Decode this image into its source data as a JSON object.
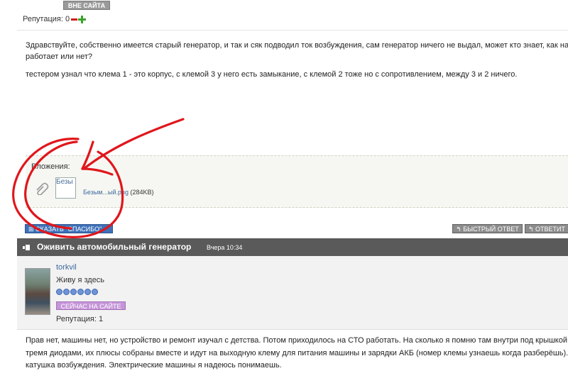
{
  "top_author": {
    "status_label": "ВНЕ САЙТА",
    "reputation_label": "Репутация: 0"
  },
  "post1": {
    "lines": [
      "Здравствуйте, собственно имеется старый генератор, и так и сяк подводил ток возбуждения, сам генератор ничего не выдал, может кто знает, как наверня",
      "работает или нет?",
      "тестером узнал что клема 1 - это корпус, с клемой 3 у него есть замыкание, с клемой 2 тоже но с сопротивлением, между 3 и 2 ничего."
    ],
    "attachments_title": "Вложения:",
    "attachment_thumb_text": "Безы",
    "attachment_name": "Безым...ый.png",
    "attachment_size": "(284KB)"
  },
  "actions": {
    "thanks_label": "СКАЗАТЬ \"СПАСИБО\"",
    "quick_reply_label": "БЫСТРЫЙ ОТВЕТ",
    "reply_label": "ОТВЕТИТ"
  },
  "post2": {
    "title": "Оживить автомобильный генератор",
    "date": "Вчера 10:34",
    "author_name": "torkvil",
    "author_title": "Живу я здесь",
    "status_label": "СЕЙЧАС НА САЙТЕ",
    "reputation_label": "Репутация: 1",
    "lines": [
      "Прав нет, машины нет, но устройство и ремонт изучал с детства. Потом приходилось на СТО работать. На сколько я помню там внутри под крышкой стоит",
      "тремя диодами, их плюсы собраны вместе и идут на выходную клему для питания машины и зарядки АКБ (номер клемы узнаешь когда разберёшь). А дру",
      "катушка возбуждения. Электрические машины я надеюсь понимаешь."
    ]
  },
  "colors": {
    "header_bg": "#5a5a5a",
    "thanks_bg": "#3d71b8",
    "online_badge": "#c695d9",
    "annotation": "#e0161b"
  }
}
